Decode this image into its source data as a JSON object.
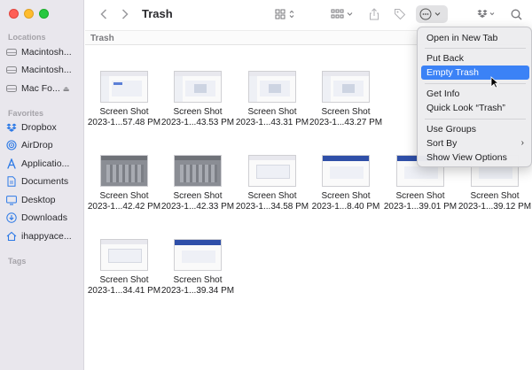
{
  "window": {
    "title": "Trash",
    "path_label": "Trash"
  },
  "sidebar": {
    "locations_heading": "Locations",
    "locations": [
      {
        "label": "Macintosh...",
        "icon": "drive-icon"
      },
      {
        "label": "Macintosh...",
        "icon": "drive-icon"
      },
      {
        "label": "Mac Fo...",
        "icon": "drive-icon"
      }
    ],
    "favorites_heading": "Favorites",
    "favorites": [
      {
        "label": "Dropbox",
        "icon": "dropbox-icon"
      },
      {
        "label": "AirDrop",
        "icon": "airdrop-icon"
      },
      {
        "label": "Applicatio...",
        "icon": "applications-icon"
      },
      {
        "label": "Documents",
        "icon": "document-icon"
      },
      {
        "label": "Desktop",
        "icon": "desktop-icon"
      },
      {
        "label": "Downloads",
        "icon": "download-icon"
      },
      {
        "label": "ihappyace...",
        "icon": "home-icon"
      }
    ],
    "tags_heading": "Tags"
  },
  "files": [
    {
      "line1": "Screen Shot",
      "line2": "2023-1...57.48 PM"
    },
    {
      "line1": "Screen Shot",
      "line2": "2023-1...43.53 PM"
    },
    {
      "line1": "Screen Shot",
      "line2": "2023-1...43.31 PM"
    },
    {
      "line1": "Screen Shot",
      "line2": "2023-1...43.27 PM"
    },
    {
      "line1": "Screen Shot",
      "line2": "2023-1...42.42 PM"
    },
    {
      "line1": "Screen Shot",
      "line2": "2023-1...42.33 PM"
    },
    {
      "line1": "Screen Shot",
      "line2": "2023-1...34.58 PM"
    },
    {
      "line1": "Screen Shot",
      "line2": "2023-1...8.40 PM"
    },
    {
      "line1": "Screen Shot",
      "line2": "2023-1...39.01 PM"
    },
    {
      "line1": "Screen Shot",
      "line2": "2023-1...39.12 PM"
    },
    {
      "line1": "Screen Shot",
      "line2": "2023-1...34.41 PM"
    },
    {
      "line1": "Screen Shot",
      "line2": "2023-1...39.34 PM"
    }
  ],
  "context_menu": {
    "open_new_tab": "Open in New Tab",
    "put_back": "Put Back",
    "empty_trash": "Empty Trash",
    "get_info": "Get Info",
    "quick_look": "Quick Look “Trash”",
    "use_groups": "Use Groups",
    "sort_by": "Sort By",
    "show_view_options": "Show View Options"
  },
  "colors": {
    "highlight": "#3b82f6",
    "sidebar_bg": "#e9e7ed",
    "accent_icon": "#2c79e6"
  }
}
